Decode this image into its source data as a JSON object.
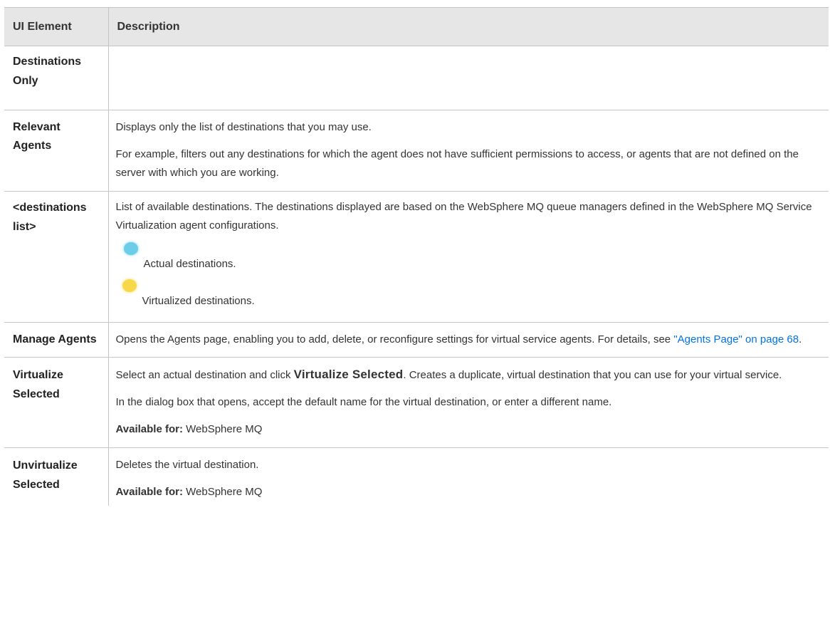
{
  "table": {
    "headers": [
      "UI Element",
      "Description"
    ],
    "rows": [
      {
        "element": "Destinations Only",
        "desc": []
      },
      {
        "element": "Relevant Agents",
        "desc": [
          "Displays only the list of destinations that you may use.",
          "For example, filters out any destinations for which the agent does not have sufficient permissions to access, or agents that are not defined on the server with which you are working."
        ]
      },
      {
        "element": "<destinations list>",
        "desc": [
          "List of available destinations. The destinations displayed are based on the WebSphere MQ queue managers defined in the WebSphere MQ Service Virtualization agent configurations."
        ],
        "legend": [
          {
            "icon": "actual-destination-icon",
            "color": "#6ccde8",
            "label": "Actual destinations."
          },
          {
            "icon": "virtualized-destination-icon",
            "color": "#f6d84a",
            "label": "Virtualized destinations."
          }
        ]
      },
      {
        "element": "Manage Agents",
        "desc_before_link": "Opens the Agents page, enabling you to add, delete, or reconfigure settings for virtual service agents. For details, see ",
        "link": "\"Agents Page\" on page 68",
        "desc_after_link": "."
      },
      {
        "element": "Virtualize Selected",
        "p1_prefix": "Select an actual destination and click ",
        "p1_bold": "Virtualize Selected",
        "p1_suffix": ". Creates a duplicate, virtual destination that you can use for your virtual service.",
        "p2": "In the dialog box that opens, accept the default name for the virtual destination, or enter a different name.",
        "avail_label": "Available for:",
        "avail_value": " WebSphere MQ"
      },
      {
        "element": "Unvirtualize Selected",
        "p1": "Deletes the virtual destination.",
        "avail_label": "Available for:",
        "avail_value": " WebSphere MQ"
      }
    ]
  },
  "colors": {
    "header_bg": "#e6e6e6",
    "border": "#c4c4c4",
    "link": "#0073e7"
  }
}
